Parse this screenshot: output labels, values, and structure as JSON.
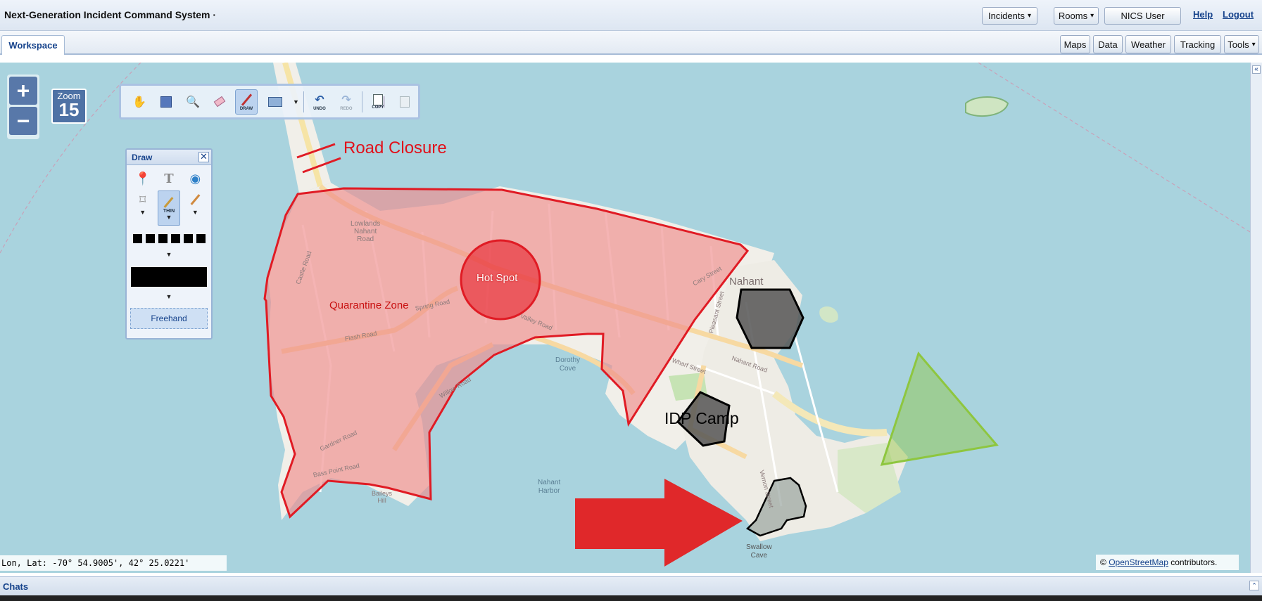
{
  "header": {
    "title": "Next-Generation Incident Command System ·",
    "incidents_label": "Incidents",
    "rooms_label": "Rooms",
    "user_label": "NICS User",
    "help_label": "Help",
    "logout_label": "Logout"
  },
  "tabs": {
    "workspace": "Workspace"
  },
  "tab_tools": {
    "maps": "Maps",
    "data": "Data",
    "weather": "Weather",
    "tracking": "Tracking",
    "tools": "Tools"
  },
  "zoom": {
    "plus": "+",
    "minus": "−",
    "label": "Zoom",
    "level": "15"
  },
  "toolbar": {
    "draw": "DRAW",
    "undo": "UNDO",
    "redo": "REDO",
    "copy": "COPY"
  },
  "draw_panel": {
    "title": "Draw",
    "close": "✕",
    "line_weight": "THIN",
    "mode": "Freehand"
  },
  "map": {
    "labels": {
      "road_closure": "Road Closure",
      "hot_spot": "Hot Spot",
      "quarantine_zone": "Quarantine Zone",
      "idp_camp": "IDP Camp",
      "nahant": "Nahant",
      "dorothy_cove_1": "Dorothy",
      "dorothy_cove_2": "Cove",
      "nahant_harbor_1": "Nahant",
      "nahant_harbor_2": "Harbor",
      "swallow_cave_1": "Swallow",
      "swallow_cave_2": "Cave"
    },
    "streets": {
      "spring_road": "Spring Road",
      "flash_road": "Flash Road",
      "valley_road": "Valley Road",
      "willow_road": "Willow Road",
      "nahant_road": "Nahant Road",
      "castle_road": "Castle Road",
      "lowlands": "Lowlands",
      "lowlands_2": "Nahant",
      "lowlands_3": "Road",
      "gardner_road": "Gardner Road",
      "bass_point_road": "Bass Point Road",
      "baileys_hill": "Baileys",
      "baileys_hill_2": "Hill",
      "vernon_street": "Vernon Street",
      "wharf_street": "Wharf Street",
      "cary_street": "Cary Street",
      "pleasant_street": "Pleasant Street"
    },
    "colors": {
      "water": "#a9d3de",
      "land": "#f1efe9",
      "quarantine_fill": "#f08c8c",
      "quarantine_stroke": "#e01b24",
      "hot_spot": "#e8202a",
      "triangle": "#8ec63f",
      "arrow": "#e0282a",
      "hexagon": "#555555"
    }
  },
  "coords": "Lon, Lat: -70° 54.9005', 42° 25.0221'",
  "attribution": {
    "prefix": "©",
    "link": "OpenStreetMap",
    "suffix": "contributors."
  },
  "chats": {
    "title": "Chats"
  }
}
